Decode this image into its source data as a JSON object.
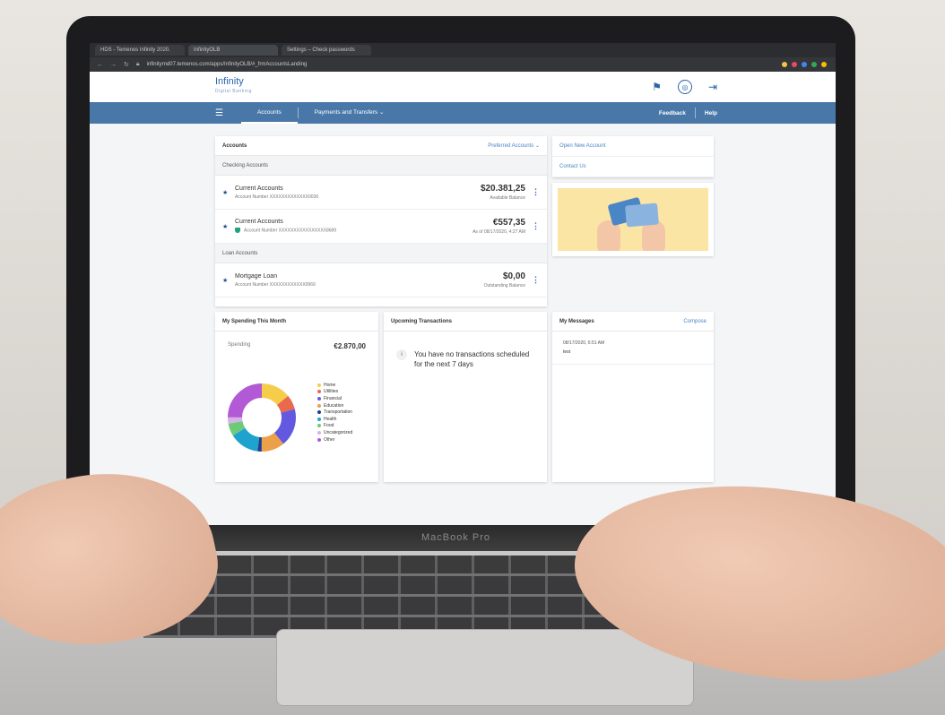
{
  "browser": {
    "tabs": [
      "HDS - Temenos Infinity 2020.",
      "InfinityOLB",
      "Settings – Check passwords"
    ],
    "url": "infinityrnd07.temenos.com/apps/InfinityOLB/#_frmAccountsLanding"
  },
  "app": {
    "logo": "Infinity",
    "logo_sub": "Digital Banking"
  },
  "nav": {
    "accounts": "Accounts",
    "payments": "Payments and Transfers",
    "feedback": "Feedback",
    "help": "Help"
  },
  "accounts": {
    "title": "Accounts",
    "preferred": "Preferred Accounts",
    "checking_header": "Checking Accounts",
    "loan_header": "Loan Accounts",
    "rows": [
      {
        "name": "Current Accounts",
        "number": "Account Number XXXXXXXXXXXXX0036",
        "amount": "$20.381,25",
        "label": "Available Balance"
      },
      {
        "name": "Current Accounts",
        "number": "Account Number XXXXXXXXXXXXXXXX8689",
        "amount": "€557,35",
        "label": "As of 08/17/2020, 4:27 AM"
      },
      {
        "name": "Mortgage Loan",
        "number": "Account Number XXXXXXXXXXXX0969",
        "amount": "$0,00",
        "label": "Outstanding Balance"
      }
    ]
  },
  "quick_links": [
    "Open New Account",
    "Contact Us"
  ],
  "spending": {
    "title": "My Spending This Month",
    "label": "Spending",
    "amount": "€2.870,00",
    "legend": [
      "Home",
      "Utilities",
      "Financial",
      "Education",
      "Transportation",
      "Health",
      "Food",
      "Uncategorized",
      "Other"
    ]
  },
  "chart_data": {
    "type": "pie",
    "categories": [
      "Home",
      "Utilities",
      "Financial",
      "Education",
      "Transportation",
      "Health",
      "Food",
      "Uncategorized",
      "Other"
    ],
    "values": [
      14,
      7,
      18,
      11,
      2,
      14,
      6,
      3,
      25
    ],
    "colors": [
      "#f6cd4a",
      "#e8694b",
      "#6358e0",
      "#eda04a",
      "#1f3d8c",
      "#1ea3cf",
      "#6cca78",
      "#d6b1e6",
      "#b25ad6"
    ]
  },
  "upcoming": {
    "title": "Upcoming Transactions",
    "message": "You have no transactions scheduled for the next 7 days"
  },
  "messages": {
    "title": "My Messages",
    "compose": "Compose",
    "items": [
      {
        "date": "08/17/2020, 6:51 AM",
        "subject": "test"
      }
    ]
  },
  "device": {
    "brand": "MacBook Pro"
  }
}
